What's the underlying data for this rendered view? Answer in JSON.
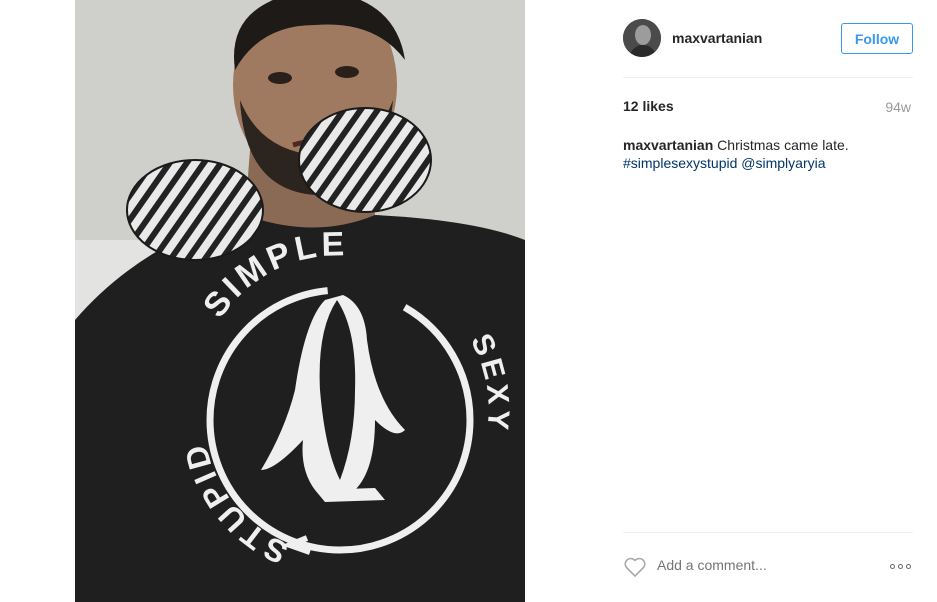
{
  "post": {
    "username": "maxvartanian",
    "follow_label": "Follow",
    "likes": "12 likes",
    "time": "94w",
    "caption_user": "maxvartanian",
    "caption_text": "Christmas came late.",
    "hashtag": "#simplesexystupid",
    "mention": "@simplyaryia",
    "comment_placeholder": "Add a comment..."
  },
  "shirt_print": {
    "top": "SIMPLE",
    "right": "SEXY",
    "bottom": "STUPID"
  },
  "colors": {
    "accent": "#3897f0",
    "link": "#003569",
    "muted": "#999999"
  },
  "icons": {
    "like": "heart-outline-icon",
    "more": "more-options-icon"
  }
}
